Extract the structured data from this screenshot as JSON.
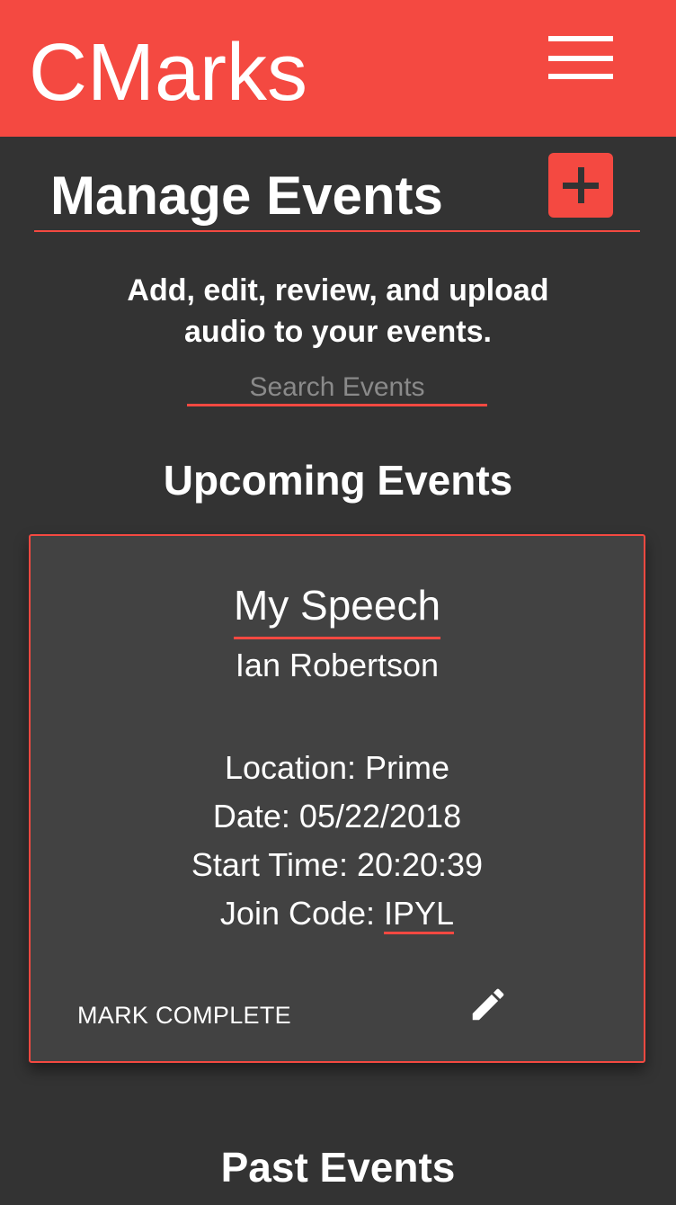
{
  "header": {
    "brand": "CMarks",
    "menu_icon": "hamburger-menu-icon"
  },
  "page": {
    "title": "Manage Events",
    "add_icon": "plus-icon",
    "subtitle_line1": "Add, edit, review, and upload",
    "subtitle_line2": "audio to your events."
  },
  "search": {
    "placeholder": "Search Events",
    "value": ""
  },
  "sections": {
    "upcoming_heading": "Upcoming Events",
    "past_heading": "Past Events"
  },
  "event": {
    "title": "My Speech",
    "owner": "Ian Robertson",
    "location": "Location: Prime",
    "date": "Date: 05/22/2018",
    "start_time": "Start Time: 20:20:39",
    "join_code_label": "Join Code: ",
    "join_code": "IPYL",
    "mark_complete_label": "MARK COMPLETE",
    "edit_icon": "pencil-icon"
  },
  "colors": {
    "accent": "#f44941",
    "background": "#333333",
    "card": "#424242",
    "text": "#ffffff"
  }
}
